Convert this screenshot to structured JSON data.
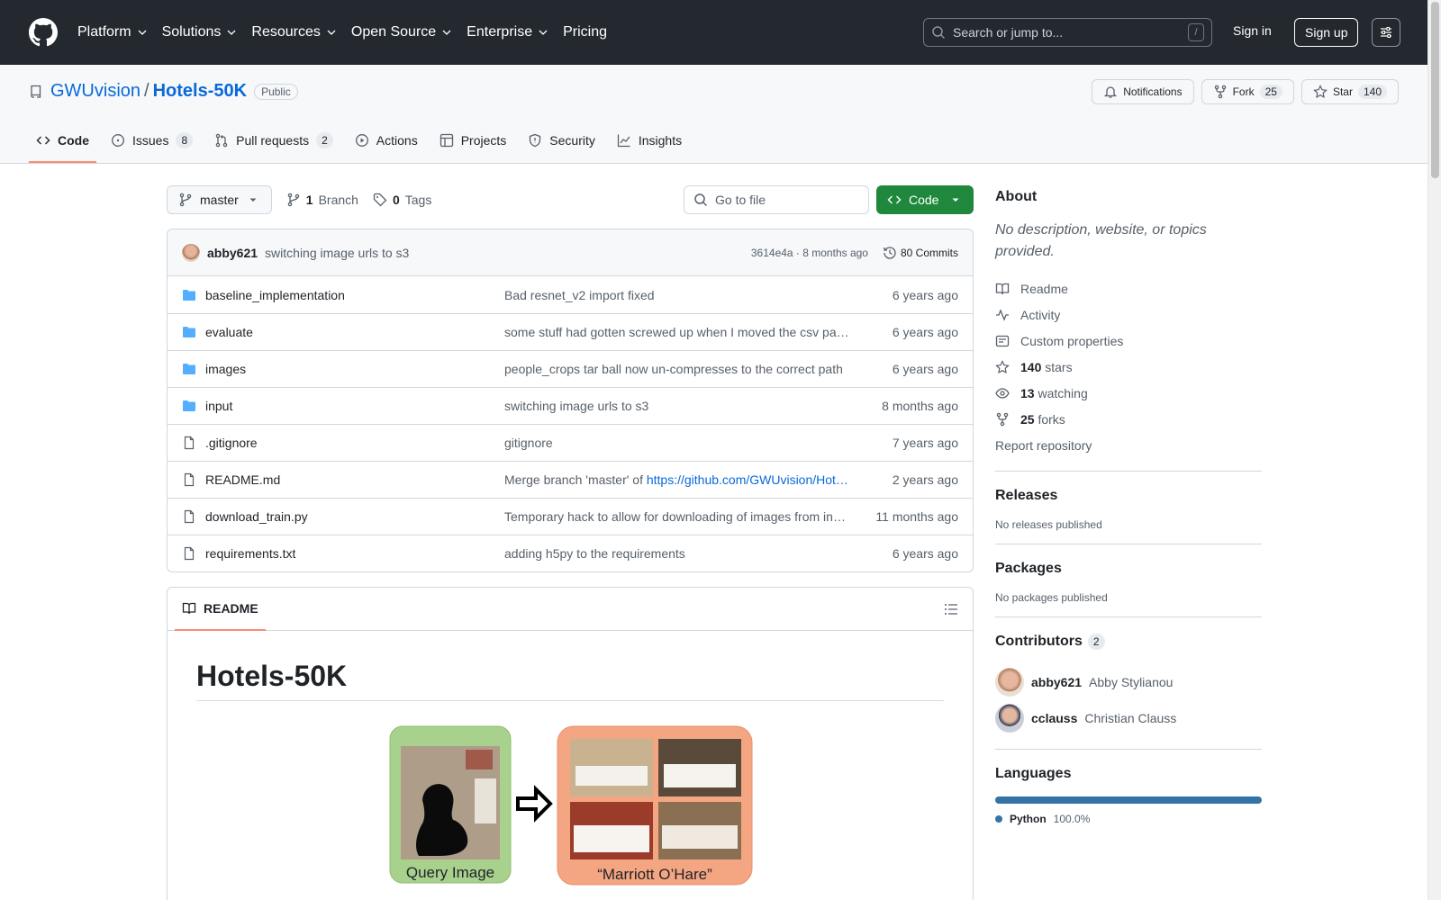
{
  "header": {
    "nav": [
      "Platform",
      "Solutions",
      "Resources",
      "Open Source",
      "Enterprise",
      "Pricing"
    ],
    "search_placeholder": "Search or jump to...",
    "search_shortcut": "/",
    "signin": "Sign in",
    "signup": "Sign up"
  },
  "repo": {
    "owner": "GWUvision",
    "separator": "/",
    "name": "Hotels-50K",
    "visibility": "Public",
    "notifications_label": "Notifications",
    "fork_label": "Fork",
    "fork_count": "25",
    "star_label": "Star",
    "star_count": "140"
  },
  "tabs": [
    {
      "label": "Code",
      "count": null,
      "icon": "code-icon"
    },
    {
      "label": "Issues",
      "count": "8",
      "icon": "issue-icon"
    },
    {
      "label": "Pull requests",
      "count": "2",
      "icon": "pull-request-icon"
    },
    {
      "label": "Actions",
      "count": null,
      "icon": "play-icon"
    },
    {
      "label": "Projects",
      "count": null,
      "icon": "table-icon"
    },
    {
      "label": "Security",
      "count": null,
      "icon": "shield-icon"
    },
    {
      "label": "Insights",
      "count": null,
      "icon": "graph-icon"
    }
  ],
  "filenav": {
    "branch": "master",
    "branch_count": "1",
    "branch_label": "Branch",
    "tag_count": "0",
    "tag_label": "Tags",
    "goto_placeholder": "Go to file",
    "code_button": "Code"
  },
  "latest_commit": {
    "author": "abby621",
    "message": "switching image urls to s3",
    "hash_time": "3614e4a · 8 months ago",
    "commit_count": "80 Commits"
  },
  "files": [
    {
      "type": "dir",
      "name": "baseline_implementation",
      "message": "Bad resnet_v2 import fixed",
      "link": "",
      "date": "6 years ago"
    },
    {
      "type": "dir",
      "name": "evaluate",
      "message": "some stuff had gotten screwed up when I moved the csv pa…",
      "link": "",
      "date": "6 years ago"
    },
    {
      "type": "dir",
      "name": "images",
      "message": "people_crops tar ball now un-compresses to the correct path",
      "link": "",
      "date": "6 years ago"
    },
    {
      "type": "dir",
      "name": "input",
      "message": "switching image urls to s3",
      "link": "",
      "date": "8 months ago"
    },
    {
      "type": "file",
      "name": ".gitignore",
      "message": "gitignore",
      "link": "",
      "date": "7 years ago"
    },
    {
      "type": "file",
      "name": "README.md",
      "message": "Merge branch 'master' of ",
      "link": "https://github.com/GWUvision/Hot…",
      "date": "2 years ago"
    },
    {
      "type": "file",
      "name": "download_train.py",
      "message": "Temporary hack to allow for downloading of images from in…",
      "link": "",
      "date": "11 months ago"
    },
    {
      "type": "file",
      "name": "requirements.txt",
      "message": "adding h5py to the requirements",
      "link": "",
      "date": "6 years ago"
    }
  ],
  "readme": {
    "tab_label": "README",
    "title": "Hotels-50K",
    "hero_query_label": "Query Image",
    "hero_result_label": "“Marriott O’Hare”"
  },
  "sidebar": {
    "about_title": "About",
    "about_desc": "No description, website, or topics provided.",
    "links": [
      {
        "icon": "book-icon",
        "bold": "",
        "text": "Readme"
      },
      {
        "icon": "pulse-icon",
        "bold": "",
        "text": "Activity"
      },
      {
        "icon": "note-icon",
        "bold": "",
        "text": "Custom properties"
      },
      {
        "icon": "star-icon",
        "bold": "140",
        "text": "stars"
      },
      {
        "icon": "eye-icon",
        "bold": "13",
        "text": "watching"
      },
      {
        "icon": "fork-icon",
        "bold": "25",
        "text": "forks"
      }
    ],
    "report": "Report repository",
    "releases_title": "Releases",
    "releases_text": "No releases published",
    "packages_title": "Packages",
    "packages_text": "No packages published",
    "contributors_title": "Contributors",
    "contributors_count": "2",
    "contributors": [
      {
        "login": "abby621",
        "name": "Abby Stylianou"
      },
      {
        "login": "cclauss",
        "name": "Christian Clauss"
      }
    ],
    "languages_title": "Languages",
    "language": {
      "name": "Python",
      "percent": "100.0%",
      "color": "#3572a5"
    }
  },
  "colors": {
    "accent": "#0969da",
    "header_bg": "#24292f",
    "code_button": "#1f883d",
    "tab_underline": "#fd8c73"
  }
}
